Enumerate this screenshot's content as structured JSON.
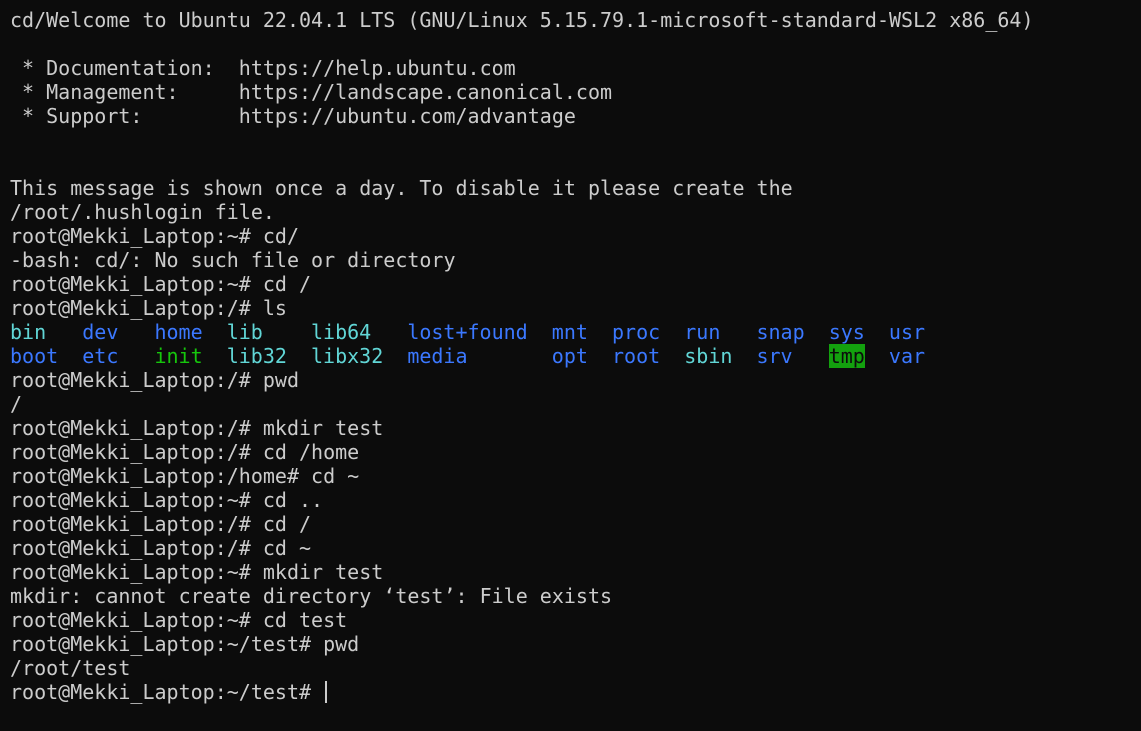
{
  "terminal": {
    "lines": [
      "cd/Welcome to Ubuntu 22.04.1 LTS (GNU/Linux 5.15.79.1-microsoft-standard-WSL2 x86_64)",
      "",
      " * Documentation:  https://help.ubuntu.com",
      " * Management:     https://landscape.canonical.com",
      " * Support:        https://ubuntu.com/advantage",
      "",
      "",
      "This message is shown once a day. To disable it please create the",
      "/root/.hushlogin file.",
      "root@Mekki_Laptop:~# cd/",
      "-bash: cd/: No such file or directory",
      "root@Mekki_Laptop:~# cd /",
      "root@Mekki_Laptop:/# ls"
    ],
    "ls_output": {
      "row1": [
        {
          "name": "bin",
          "kind": "link"
        },
        {
          "name": "dev",
          "kind": "dir"
        },
        {
          "name": "home",
          "kind": "dir"
        },
        {
          "name": "lib",
          "kind": "link"
        },
        {
          "name": "lib64",
          "kind": "link"
        },
        {
          "name": "lost+found",
          "kind": "dir"
        },
        {
          "name": "mnt",
          "kind": "dir"
        },
        {
          "name": "proc",
          "kind": "dir"
        },
        {
          "name": "run",
          "kind": "dir"
        },
        {
          "name": "snap",
          "kind": "dir"
        },
        {
          "name": "sys",
          "kind": "dir"
        },
        {
          "name": "usr",
          "kind": "dir"
        }
      ],
      "row2": [
        {
          "name": "boot",
          "kind": "dir"
        },
        {
          "name": "etc",
          "kind": "dir"
        },
        {
          "name": "init",
          "kind": "exec"
        },
        {
          "name": "lib32",
          "kind": "link"
        },
        {
          "name": "libx32",
          "kind": "link"
        },
        {
          "name": "media",
          "kind": "dir"
        },
        {
          "name": "opt",
          "kind": "dir"
        },
        {
          "name": "root",
          "kind": "dir"
        },
        {
          "name": "sbin",
          "kind": "link"
        },
        {
          "name": "srv",
          "kind": "dir"
        },
        {
          "name": "tmp",
          "kind": "sticky"
        },
        {
          "name": "var",
          "kind": "dir"
        }
      ]
    },
    "after_lines": [
      "root@Mekki_Laptop:/# pwd",
      "/",
      "root@Mekki_Laptop:/# mkdir test",
      "root@Mekki_Laptop:/# cd /home",
      "root@Mekki_Laptop:/home# cd ~",
      "root@Mekki_Laptop:~# cd ..",
      "root@Mekki_Laptop:/# cd /",
      "root@Mekki_Laptop:/# cd ~",
      "root@Mekki_Laptop:~# mkdir test",
      "mkdir: cannot create directory ‘test’: File exists",
      "root@Mekki_Laptop:~# cd test",
      "root@Mekki_Laptop:~/test# pwd",
      "/root/test"
    ],
    "prompt": "root@Mekki_Laptop:~/test# "
  }
}
